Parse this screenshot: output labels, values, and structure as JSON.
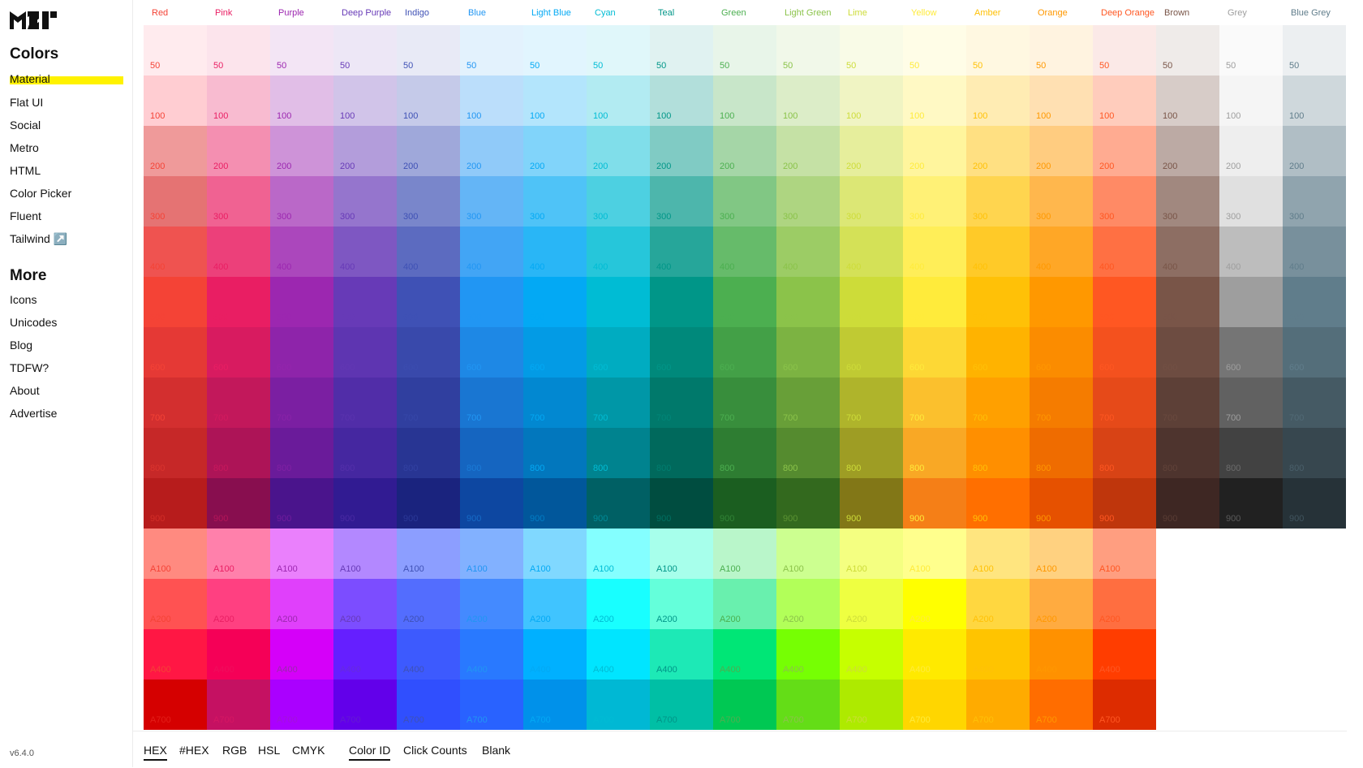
{
  "sidebar": {
    "colors_heading": "Colors",
    "colors_items": [
      "Material",
      "Flat UI",
      "Social",
      "Metro",
      "HTML",
      "Color Picker",
      "Fluent",
      "Tailwind ↗️"
    ],
    "more_heading": "More",
    "more_items": [
      "Icons",
      "Unicodes",
      "Blog",
      "TDFW?",
      "About",
      "Advertise"
    ],
    "version": "v6.4.0",
    "highlight_color": "#fff200"
  },
  "palette": {
    "columns": [
      {
        "name": "Red",
        "label_color": "#f44336",
        "swatches": [
          "#ffebee",
          "#ffcdd2",
          "#ef9a9a",
          "#e57373",
          "#ef5350",
          "#f44336",
          "#e53935",
          "#d32f2f",
          "#c62828",
          "#b71c1c",
          "#ff8a80",
          "#ff5252",
          "#ff1744",
          "#d50000"
        ]
      },
      {
        "name": "Pink",
        "label_color": "#e91e63",
        "swatches": [
          "#fce4ec",
          "#f8bbd0",
          "#f48fb1",
          "#f06292",
          "#ec407a",
          "#e91e63",
          "#d81b60",
          "#c2185b",
          "#ad1457",
          "#880e4f",
          "#ff80ab",
          "#ff4081",
          "#f50057",
          "#c51162"
        ]
      },
      {
        "name": "Purple",
        "label_color": "#9c27b0",
        "swatches": [
          "#f3e5f5",
          "#e1bee7",
          "#ce93d8",
          "#ba68c8",
          "#ab47bc",
          "#9c27b0",
          "#8e24aa",
          "#7b1fa2",
          "#6a1b9a",
          "#4a148c",
          "#ea80fc",
          "#e040fb",
          "#d500f9",
          "#aa00ff"
        ]
      },
      {
        "name": "Deep Purple",
        "label_color": "#673ab7",
        "swatches": [
          "#ede7f6",
          "#d1c4e9",
          "#b39ddb",
          "#9575cd",
          "#7e57c2",
          "#673ab7",
          "#5e35b1",
          "#512da8",
          "#4527a0",
          "#311b92",
          "#b388ff",
          "#7c4dff",
          "#651fff",
          "#6200ea"
        ]
      },
      {
        "name": "Indigo",
        "label_color": "#3f51b5",
        "swatches": [
          "#e8eaf6",
          "#c5cae9",
          "#9fa8da",
          "#7986cb",
          "#5c6bc0",
          "#3f51b5",
          "#3949ab",
          "#303f9f",
          "#283593",
          "#1a237e",
          "#8c9eff",
          "#536dfe",
          "#3d5afe",
          "#304ffe"
        ]
      },
      {
        "name": "Blue",
        "label_color": "#2196f3",
        "swatches": [
          "#e3f2fd",
          "#bbdefb",
          "#90caf9",
          "#64b5f6",
          "#42a5f5",
          "#2196f3",
          "#1e88e5",
          "#1976d2",
          "#1565c0",
          "#0d47a1",
          "#82b1ff",
          "#448aff",
          "#2979ff",
          "#2962ff"
        ]
      },
      {
        "name": "Light Blue",
        "label_color": "#03a9f4",
        "swatches": [
          "#e1f5fe",
          "#b3e5fc",
          "#81d4fa",
          "#4fc3f7",
          "#29b6f6",
          "#03a9f4",
          "#039be5",
          "#0288d1",
          "#0277bd",
          "#01579b",
          "#80d8ff",
          "#40c4ff",
          "#00b0ff",
          "#0091ea"
        ]
      },
      {
        "name": "Cyan",
        "label_color": "#00bcd4",
        "swatches": [
          "#e0f7fa",
          "#b2ebf2",
          "#80deea",
          "#4dd0e1",
          "#26c6da",
          "#00bcd4",
          "#00acc1",
          "#0097a7",
          "#00838f",
          "#006064",
          "#84ffff",
          "#18ffff",
          "#00e5ff",
          "#00b8d4"
        ]
      },
      {
        "name": "Teal",
        "label_color": "#009688",
        "swatches": [
          "#e0f2f1",
          "#b2dfdb",
          "#80cbc4",
          "#4db6ac",
          "#26a69a",
          "#009688",
          "#00897b",
          "#00796b",
          "#00695c",
          "#004d40",
          "#a7ffeb",
          "#64ffda",
          "#1de9b6",
          "#00bfa5"
        ]
      },
      {
        "name": "Green",
        "label_color": "#4caf50",
        "swatches": [
          "#e8f5e9",
          "#c8e6c9",
          "#a5d6a7",
          "#81c784",
          "#66bb6a",
          "#4caf50",
          "#43a047",
          "#388e3c",
          "#2e7d32",
          "#1b5e20",
          "#b9f6ca",
          "#69f0ae",
          "#00e676",
          "#00c853"
        ]
      },
      {
        "name": "Light Green",
        "label_color": "#8bc34a",
        "swatches": [
          "#f1f8e9",
          "#dcedc8",
          "#c5e1a5",
          "#aed581",
          "#9ccc65",
          "#8bc34a",
          "#7cb342",
          "#689f38",
          "#558b2f",
          "#33691e",
          "#ccff90",
          "#b2ff59",
          "#76ff03",
          "#64dd17"
        ]
      },
      {
        "name": "Lime",
        "label_color": "#cddc39",
        "swatches": [
          "#f9fbe7",
          "#f0f4c3",
          "#e6ee9c",
          "#dce775",
          "#d4e157",
          "#cddc39",
          "#c0ca33",
          "#afb42b",
          "#9e9d24",
          "#827717",
          "#f4ff81",
          "#eeff41",
          "#c6ff00",
          "#aeea00"
        ]
      },
      {
        "name": "Yellow",
        "label_color": "#ffeb3b",
        "swatches": [
          "#fffde7",
          "#fff9c4",
          "#fff59d",
          "#fff176",
          "#ffee58",
          "#ffeb3b",
          "#fdd835",
          "#fbc02d",
          "#f9a825",
          "#f57f17",
          "#ffff8d",
          "#ffff00",
          "#ffea00",
          "#ffd600"
        ]
      },
      {
        "name": "Amber",
        "label_color": "#ffc107",
        "swatches": [
          "#fff8e1",
          "#ffecb3",
          "#ffe082",
          "#ffd54f",
          "#ffca28",
          "#ffc107",
          "#ffb300",
          "#ffa000",
          "#ff8f00",
          "#ff6f00",
          "#ffe57f",
          "#ffd740",
          "#ffc400",
          "#ffab00"
        ]
      },
      {
        "name": "Orange",
        "label_color": "#ff9800",
        "swatches": [
          "#fff3e0",
          "#ffe0b2",
          "#ffcc80",
          "#ffb74d",
          "#ffa726",
          "#ff9800",
          "#fb8c00",
          "#f57c00",
          "#ef6c00",
          "#e65100",
          "#ffd180",
          "#ffab40",
          "#ff9100",
          "#ff6d00"
        ]
      },
      {
        "name": "Deep Orange",
        "label_color": "#ff5722",
        "swatches": [
          "#fbe9e7",
          "#ffccbc",
          "#ffab91",
          "#ff8a65",
          "#ff7043",
          "#ff5722",
          "#f4511e",
          "#e64a19",
          "#d84315",
          "#bf360c",
          "#ff9e80",
          "#ff6e40",
          "#ff3d00",
          "#dd2c00"
        ]
      },
      {
        "name": "Brown",
        "label_color": "#795548",
        "swatches": [
          "#efebe9",
          "#d7ccc8",
          "#bcaaa4",
          "#a1887f",
          "#8d6e63",
          "#795548",
          "#6d4c41",
          "#5d4037",
          "#4e342e",
          "#3e2723"
        ]
      },
      {
        "name": "Grey",
        "label_color": "#9e9e9e",
        "swatches": [
          "#fafafa",
          "#f5f5f5",
          "#eeeeee",
          "#e0e0e0",
          "#bdbdbd",
          "#9e9e9e",
          "#757575",
          "#616161",
          "#424242",
          "#212121"
        ]
      },
      {
        "name": "Blue Grey",
        "label_color": "#607d8b",
        "swatches": [
          "#eceff1",
          "#cfd8dc",
          "#b0bec5",
          "#90a4ae",
          "#78909c",
          "#607d8b",
          "#546e7a",
          "#455a64",
          "#37474f",
          "#263238"
        ]
      }
    ],
    "shades": [
      "50",
      "100",
      "200",
      "300",
      "400",
      "500",
      "600",
      "700",
      "800",
      "900",
      "A100",
      "A200",
      "A400",
      "A700"
    ]
  },
  "bottom_tabs": {
    "format": [
      "HEX",
      "#HEX",
      "RGB",
      "HSL",
      "CMYK"
    ],
    "mode": [
      "Color ID",
      "Click Counts",
      "Blank"
    ],
    "active_format": "HEX",
    "active_mode": "Color ID"
  }
}
